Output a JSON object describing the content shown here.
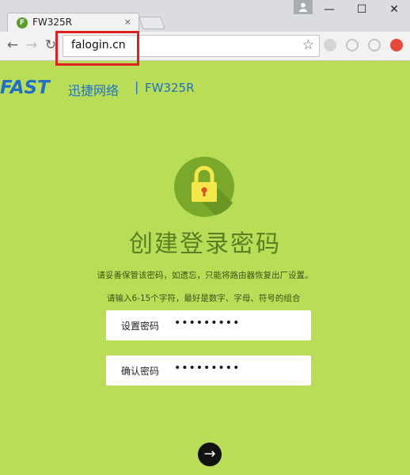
{
  "browser": {
    "tab_title": "FW325R",
    "tab_favicon_letter": "F",
    "tab_close": "×",
    "url": "falogin.cn",
    "window_controls": {
      "minimize": "—",
      "maximize": "☐",
      "close": "✕"
    },
    "nav_icons": [
      "back-arrow-icon",
      "forward-arrow-icon",
      "reload-icon"
    ],
    "extension_icons": [
      "shield-extension-icon",
      "record-extension-icon",
      "record-extension-icon-2",
      "warning-extension-icon"
    ],
    "highlight_color": "#e02020"
  },
  "brand": {
    "logo": "FAST",
    "name_cn": "迅捷网络",
    "separator": "|",
    "model": "FW325R",
    "color": "#1f70c8"
  },
  "page": {
    "background": "#b9dd57",
    "heading": "创建登录密码",
    "subtext": "请妥善保管该密码，如遗忘，只能将路由器恢复出厂设置。",
    "hint": "请输入6-15个字符，最好是数字、字母、符号的组合",
    "fields": [
      {
        "label": "设置密码",
        "value": "•••••••••"
      },
      {
        "label": "确认密码",
        "value": "•••••••••"
      }
    ],
    "next_icon": "→"
  }
}
